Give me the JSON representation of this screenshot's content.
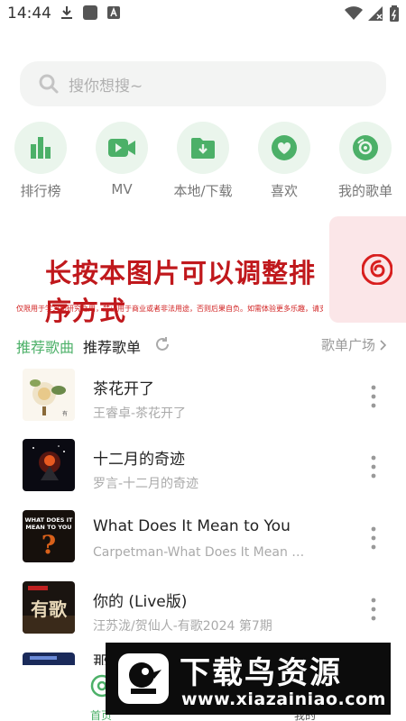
{
  "status_bar": {
    "time": "14:44"
  },
  "search": {
    "placeholder": "搜你想搜~"
  },
  "quick_actions": [
    {
      "label": "排行榜",
      "icon": "bar-chart-icon"
    },
    {
      "label": "MV",
      "icon": "video-camera-icon"
    },
    {
      "label": "本地/下载",
      "icon": "folder-download-icon"
    },
    {
      "label": "喜欢",
      "icon": "heart-icon"
    },
    {
      "label": "我的歌单",
      "icon": "disc-icon"
    }
  ],
  "banner": {
    "title": "长按本图片可以调整排序方式",
    "subtitle": "仅限用于学习和研究之用，禁止用于商业或者非法用途，否则后果自负。如需体验更多乐趣，请支持正版音乐！"
  },
  "tabs": {
    "recommended": "推荐歌曲",
    "playlists": "推荐歌单",
    "more": "歌单广场"
  },
  "songs": [
    {
      "title": "茶花开了",
      "subtitle": "王睿卓-茶花开了"
    },
    {
      "title": "十二月的奇迹",
      "subtitle": "罗言-十二月的奇迹"
    },
    {
      "title": "What Does It Mean to You",
      "subtitle": "Carpetman-What Does It Mean to You"
    },
    {
      "title": "你的 (Live版)",
      "subtitle": "汪苏泷/贺仙人-有歌2024 第7期"
    },
    {
      "title": "那"
    }
  ],
  "bottom_nav": {
    "home": "首页",
    "mine": "我的"
  },
  "watermark": {
    "title": "下载鸟资源",
    "url": "www.xiazainiao.com"
  },
  "colors": {
    "accent": "#4cb068",
    "accent_light": "#eaf5ec",
    "banner_red": "#c0181c"
  }
}
